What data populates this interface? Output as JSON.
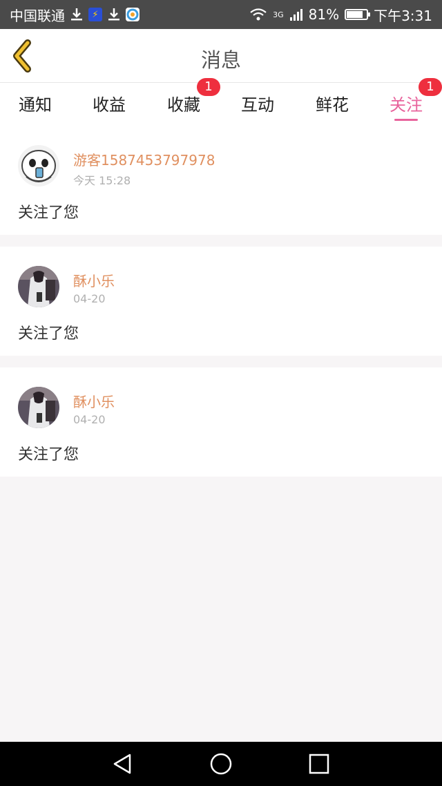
{
  "statusbar": {
    "carrier": "中国联通",
    "signal_label": "3G",
    "battery": "81%",
    "battery_level": 0.81,
    "time": "下午3:31",
    "icons": [
      "download-icon",
      "flash-app-icon",
      "download-icon",
      "app-icon",
      "wifi-icon",
      "signal-icon",
      "battery-icon"
    ]
  },
  "header": {
    "title": "消息",
    "back_icon": "chevron-left-icon",
    "accent": "#f0c030"
  },
  "tabs": [
    {
      "label": "通知",
      "active": false,
      "badge": ""
    },
    {
      "label": "收益",
      "active": false,
      "badge": ""
    },
    {
      "label": "收藏",
      "active": false,
      "badge": "1"
    },
    {
      "label": "互动",
      "active": false,
      "badge": ""
    },
    {
      "label": "鲜花",
      "active": false,
      "badge": ""
    },
    {
      "label": "关注",
      "active": true,
      "badge": "1"
    }
  ],
  "colors": {
    "accent_pink": "#e8639c",
    "badge_red": "#ee2f3e",
    "username_orange": "#e09060"
  },
  "messages": [
    {
      "user": "游客1587453797978",
      "time": "今天 15:28",
      "text": "关注了您",
      "avatar": "cartoon-avatar"
    },
    {
      "user": "酥小乐",
      "time": "04-20",
      "text": "关注了您",
      "avatar": "photo-avatar"
    },
    {
      "user": "酥小乐",
      "time": "04-20",
      "text": "关注了您",
      "avatar": "photo-avatar"
    }
  ],
  "navbar": {
    "icons": [
      "back-triangle-icon",
      "home-circle-icon",
      "recents-square-icon"
    ]
  }
}
